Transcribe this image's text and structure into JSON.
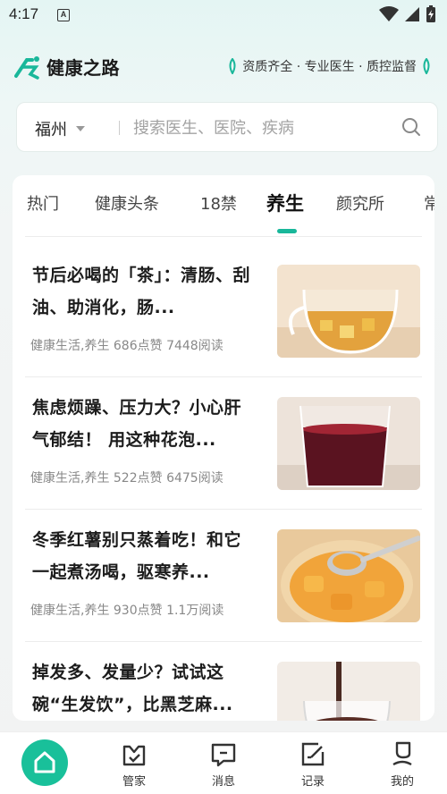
{
  "status_bar": {
    "time": "4:17",
    "notification_badge": "A"
  },
  "header": {
    "logo_text": "健康之路",
    "slogan": "资质齐全 · 专业医生 · 质控监督"
  },
  "search": {
    "city": "福州",
    "placeholder": "搜索医生、医院、疾病"
  },
  "tabs": [
    {
      "label": "热门",
      "active": false
    },
    {
      "label": "健康头条",
      "active": false
    },
    {
      "label": "18禁",
      "active": false
    },
    {
      "label": "养生",
      "active": true
    },
    {
      "label": "颜究所",
      "active": false
    },
    {
      "label": "常",
      "active": false
    }
  ],
  "articles": [
    {
      "title": "节后必喝的「茶」：清肠、刮油、助消化，肠...",
      "meta": "健康生活,养生  686点赞  7448阅读",
      "thumb": "tea-glass-image"
    },
    {
      "title": "焦虑烦躁、压力大？小心肝气郁结！ 用这种花泡...",
      "meta": "健康生活,养生  522点赞  6475阅读",
      "thumb": "red-drink-image"
    },
    {
      "title": "冬季红薯别只蒸着吃！和它一起煮汤喝，驱寒养...",
      "meta": "健康生活,养生  930点赞  1.1万阅读",
      "thumb": "sweet-potato-soup-image"
    },
    {
      "title": "掉发多、发量少？试试这碗“生发饮”，比黑芝麻...",
      "meta": "",
      "thumb": "black-sesame-drink-image"
    }
  ],
  "bottom_nav": [
    {
      "label": "",
      "icon": "home-icon",
      "active": true
    },
    {
      "label": "管家",
      "icon": "butler-icon",
      "active": false
    },
    {
      "label": "消息",
      "icon": "message-icon",
      "active": false
    },
    {
      "label": "记录",
      "icon": "record-icon",
      "active": false
    },
    {
      "label": "我的",
      "icon": "profile-icon",
      "active": false
    }
  ],
  "colors": {
    "accent": "#19b79a",
    "home_button": "#19c09a"
  }
}
